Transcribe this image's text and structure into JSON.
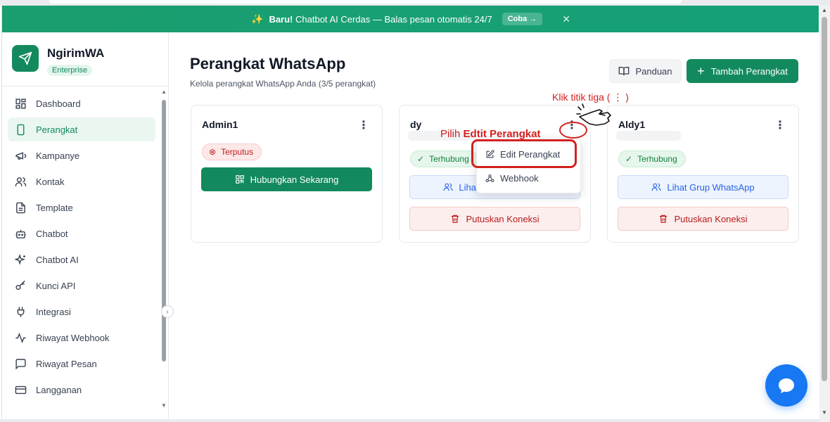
{
  "banner": {
    "icon": "sparkle-icon",
    "lead": "Baru!",
    "text": "Chatbot AI Cerdas — Balas pesan otomatis 24/7",
    "cta": "Coba →",
    "close": "✕"
  },
  "brand": {
    "name": "NgirimWA",
    "plan": "Enterprise"
  },
  "sidebar": {
    "items": [
      {
        "label": "Dashboard",
        "icon": "grid-icon",
        "active": false
      },
      {
        "label": "Perangkat",
        "icon": "smartphone-icon",
        "active": true
      },
      {
        "label": "Kampanye",
        "icon": "megaphone-icon",
        "active": false
      },
      {
        "label": "Kontak",
        "icon": "users-icon",
        "active": false
      },
      {
        "label": "Template",
        "icon": "file-icon",
        "active": false
      },
      {
        "label": "Chatbot",
        "icon": "bot-icon",
        "active": false
      },
      {
        "label": "Chatbot AI",
        "icon": "sparkles-icon",
        "active": false
      },
      {
        "label": "Kunci API",
        "icon": "key-icon",
        "active": false
      },
      {
        "label": "Integrasi",
        "icon": "plug-icon",
        "active": false
      },
      {
        "label": "Riwayat Webhook",
        "icon": "activity-icon",
        "active": false
      },
      {
        "label": "Riwayat Pesan",
        "icon": "message-square-icon",
        "active": false
      },
      {
        "label": "Langganan",
        "icon": "credit-card-icon",
        "active": false
      }
    ]
  },
  "header": {
    "title": "Perangkat WhatsApp",
    "subtitle": "Kelola perangkat WhatsApp Anda (3/5 perangkat)",
    "guide_label": "Panduan",
    "add_label": "Tambah Perangkat",
    "add_icon": "+"
  },
  "devices": [
    {
      "name": "Admin1",
      "status": "Terputus",
      "status_type": "disconnected",
      "primary_action": "Hubungkan Sekarang"
    },
    {
      "name": "dy",
      "status": "Terhubung",
      "status_type": "connected",
      "groups_action": "Lihat Grup WhatsApp",
      "disconnect_action": "Putuskan Koneksi"
    },
    {
      "name": "Aldy1",
      "status": "Terhubung",
      "status_type": "connected",
      "groups_action": "Lihat Grup WhatsApp",
      "disconnect_action": "Putuskan Koneksi"
    }
  ],
  "kebab_glyph": "⋮",
  "menu": {
    "items": [
      {
        "label": "Edit Perangkat",
        "icon": "edit-icon"
      },
      {
        "label": "Webhook",
        "icon": "webhook-icon"
      }
    ]
  },
  "annotations": {
    "pick_prefix": "Pilih",
    "pick_bold": "Edtit Perangkat",
    "click_hint": "Klik titik tiga ( ⋮ )"
  },
  "colors": {
    "brand_green": "#138a5e",
    "banner_green": "#1a9e6e",
    "annotation_red": "#d32020",
    "link_blue": "#2563eb",
    "fab_blue": "#1877f2"
  }
}
